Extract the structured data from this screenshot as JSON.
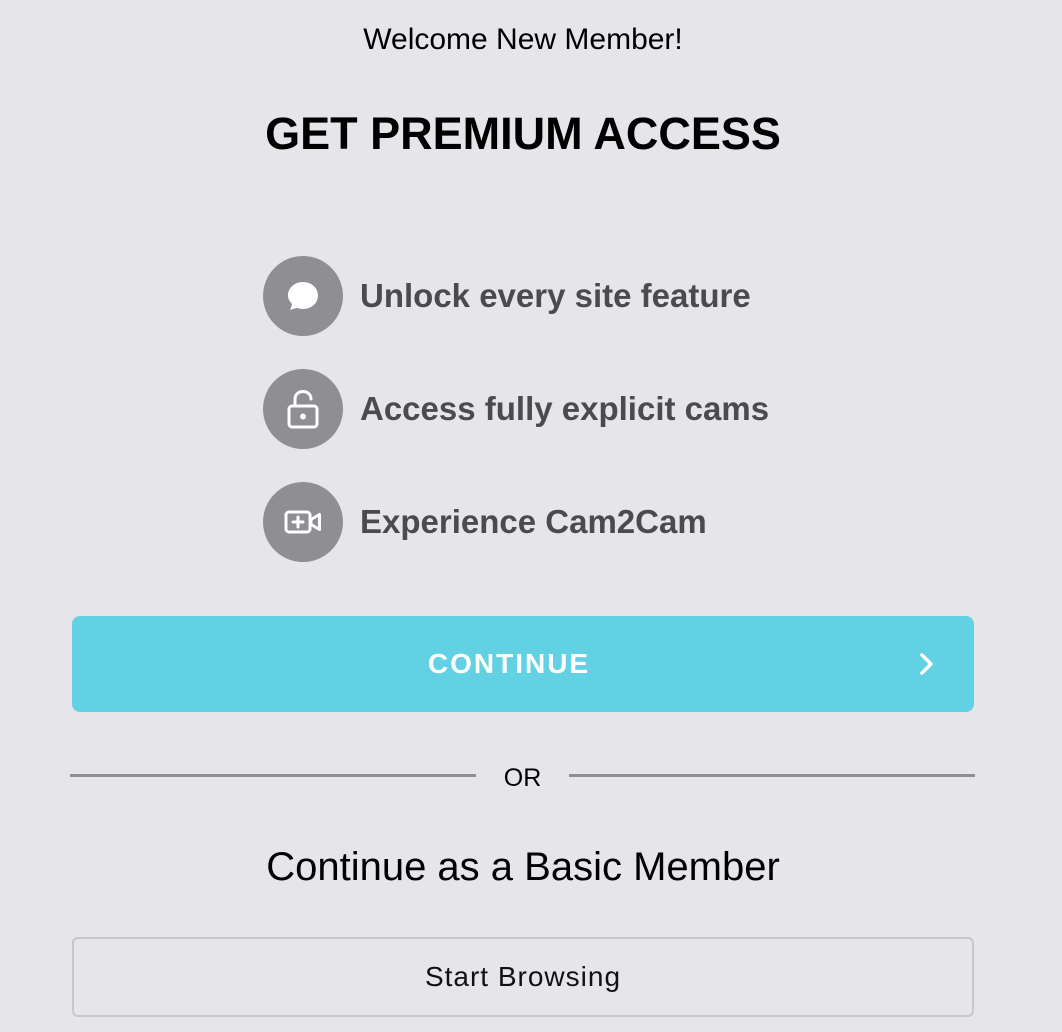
{
  "header": {
    "welcome": "Welcome New Member!",
    "title": "GET PREMIUM ACCESS"
  },
  "features": [
    {
      "icon": "chat-bubble-icon",
      "label": "Unlock every site feature"
    },
    {
      "icon": "unlock-icon",
      "label": "Access fully explicit cams"
    },
    {
      "icon": "video-plus-icon",
      "label": "Experience Cam2Cam"
    }
  ],
  "continue_button": {
    "label": "CONTINUE",
    "icon": "chevron-right-icon"
  },
  "divider": {
    "label": "OR"
  },
  "basic": {
    "title": "Continue as a Basic Member",
    "button_label": "Start Browsing"
  },
  "colors": {
    "background": "#e6e5ea",
    "accent": "#63d1e4",
    "icon_circle": "#8e8e93",
    "feature_text": "#4a4a4f"
  }
}
